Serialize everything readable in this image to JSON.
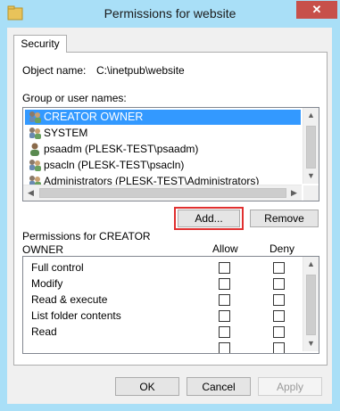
{
  "window": {
    "title": "Permissions for website",
    "close_glyph": "✕"
  },
  "tabs": [
    {
      "label": "Security"
    }
  ],
  "object": {
    "label": "Object name:",
    "value": "C:\\inetpub\\website"
  },
  "groups": {
    "label": "Group or user names:",
    "items": [
      {
        "name": "CREATOR OWNER",
        "icon": "group-icon",
        "selected": true
      },
      {
        "name": "SYSTEM",
        "icon": "group-icon",
        "selected": false
      },
      {
        "name": "psaadm (PLESK-TEST\\psaadm)",
        "icon": "user-icon",
        "selected": false
      },
      {
        "name": "psacln (PLESK-TEST\\psacln)",
        "icon": "group-icon",
        "selected": false
      },
      {
        "name": "Administrators (PLESK-TEST\\Administrators)",
        "icon": "group-icon",
        "selected": false
      }
    ],
    "add_label": "Add...",
    "remove_label": "Remove"
  },
  "permissions": {
    "label": "Permissions for CREATOR OWNER",
    "allow_label": "Allow",
    "deny_label": "Deny",
    "rows": [
      {
        "name": "Full control",
        "allow": false,
        "deny": false
      },
      {
        "name": "Modify",
        "allow": false,
        "deny": false
      },
      {
        "name": "Read & execute",
        "allow": false,
        "deny": false
      },
      {
        "name": "List folder contents",
        "allow": false,
        "deny": false
      },
      {
        "name": "Read",
        "allow": false,
        "deny": false
      }
    ]
  },
  "footer": {
    "ok_label": "OK",
    "cancel_label": "Cancel",
    "apply_label": "Apply"
  },
  "colors": {
    "title_bar": "#a9dff7",
    "selection": "#3399ff",
    "close": "#c7504a",
    "highlight": "#e03030"
  }
}
